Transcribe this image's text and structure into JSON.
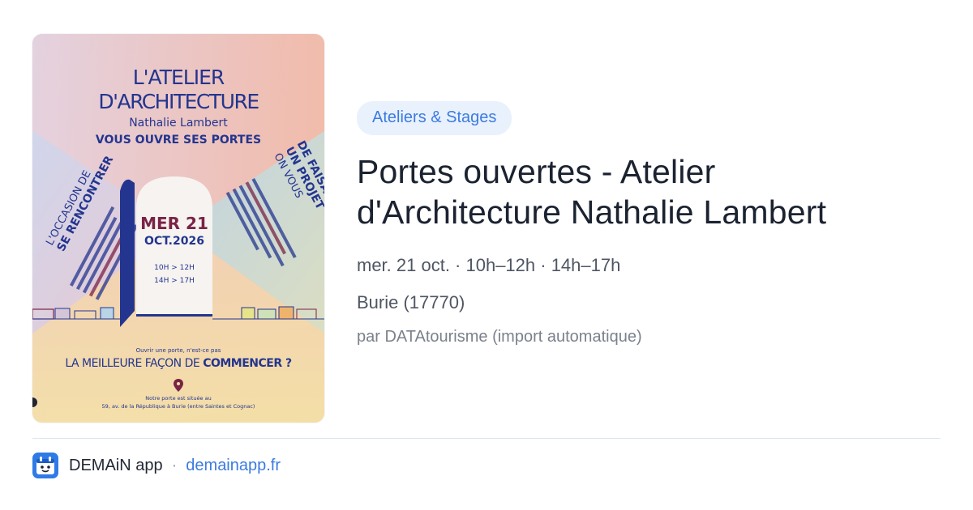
{
  "poster": {
    "heading_line1": "L'ATELIER",
    "heading_line2": "D'ARCHITECTURE",
    "name": "Nathalie Lambert",
    "tagline": "VOUS OUVRE SES PORTES",
    "left_band_1": "L'OCCASION DE",
    "left_band_2": "SE RENCONTRER",
    "right_band_1": "ON VOUS",
    "right_band_2": "UN PROJET",
    "right_band_3": "DE FAISABILITÉ",
    "date_line1": "MER 21",
    "date_line2": "OCT.2026",
    "hours_1": "10H > 12H",
    "hours_2": "14H > 17H",
    "small_question": "Ouvrir une porte, n'est-ce pas",
    "question_part1": "LA MEILLEURE FAÇON DE ",
    "question_part2": "COMMENCER ?",
    "address_1": "Notre porte est située au",
    "address_2": "59, av. de la République à Burie (entre Saintes et Cognac)"
  },
  "event": {
    "category": "Ateliers & Stages",
    "title_line1": "Portes ouvertes - Atelier",
    "title_line2": "d'Architecture Nathalie Lambert",
    "when": "mer. 21 oct. · 10h–12h · 14h–17h",
    "where": "Burie (17770)",
    "source": "par DATAtourisme (import automatique)"
  },
  "footer": {
    "app_name": "DEMAiN app",
    "separator": "·",
    "domain": "demainapp.fr",
    "icon": "calendar-face-icon"
  },
  "colors": {
    "accent": "#3b7be0",
    "chip_bg": "#e9f1fd",
    "poster_navy": "#23358f",
    "poster_plum": "#7a2346"
  }
}
